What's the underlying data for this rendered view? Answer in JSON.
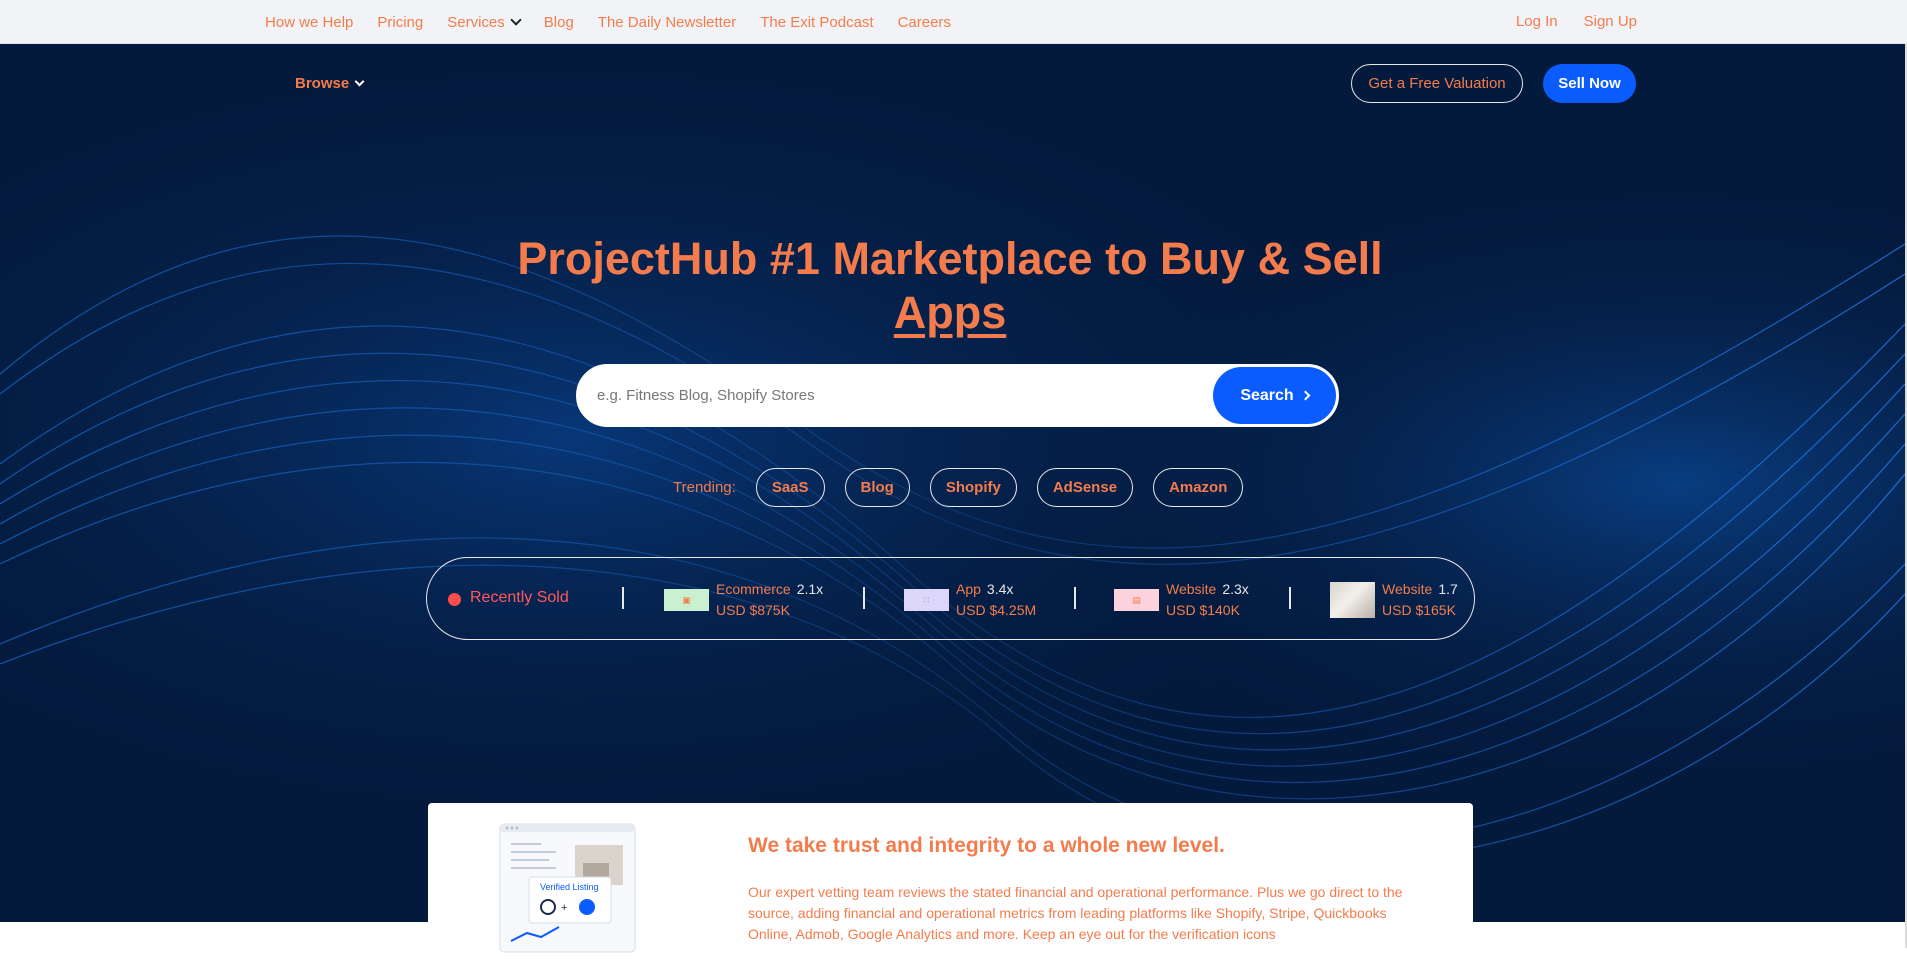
{
  "topnav": {
    "links": [
      "How we Help",
      "Pricing",
      "Services",
      "Blog",
      "The Daily Newsletter",
      "The Exit Podcast",
      "Careers"
    ],
    "auth": {
      "login": "Log In",
      "signup": "Sign Up"
    }
  },
  "header": {
    "browse_label": "Browse",
    "valuation_label": "Get a Free Valuation",
    "sell_label": "Sell Now"
  },
  "hero": {
    "headline_line1": "ProjectHub #1 Marketplace to Buy & Sell",
    "headline_line2": "Apps"
  },
  "search": {
    "placeholder": "e.g. Fitness Blog, Shopify Stores",
    "value": "",
    "button_label": "Search"
  },
  "trending": {
    "label": "Trending:",
    "tags": [
      "SaaS",
      "Blog",
      "Shopify",
      "AdSense",
      "Amazon"
    ]
  },
  "recently_sold": {
    "label": "Recently Sold",
    "items": [
      {
        "category": "Ecommerce",
        "multiple": "2.1x",
        "price": "USD $875K",
        "icon": "shop-icon",
        "thumb_color": "#c9f0cf"
      },
      {
        "category": "App",
        "multiple": "3.4x",
        "price": "USD $4.25M",
        "icon": "grid-icon",
        "thumb_color": "#ddd6fb"
      },
      {
        "category": "Website",
        "multiple": "2.3x",
        "price": "USD $140K",
        "icon": "browser-icon",
        "thumb_color": "#fcd3dc"
      },
      {
        "category": "Website",
        "multiple": "1.7",
        "price": "USD $165K",
        "icon": "photo-thumbnail",
        "thumb_color": "#e5dfd8"
      }
    ]
  },
  "trust": {
    "title": "We take trust and integrity to a whole new level.",
    "body": "Our expert vetting team reviews the stated financial and operational performance. Plus we go direct to the source, adding financial and operational metrics from leading platforms like Shopify, Stripe, Quickbooks Online, Admob, Google Analytics and more. Keep an eye out for the verification icons",
    "badge_label": "Verified Listing"
  },
  "colors": {
    "accent": "#f47c4c",
    "primary_button": "#0a5cff",
    "hero_bg": "#041a3d",
    "topbar_bg": "#f2f3f7",
    "live_dot": "#ff4d4d"
  }
}
